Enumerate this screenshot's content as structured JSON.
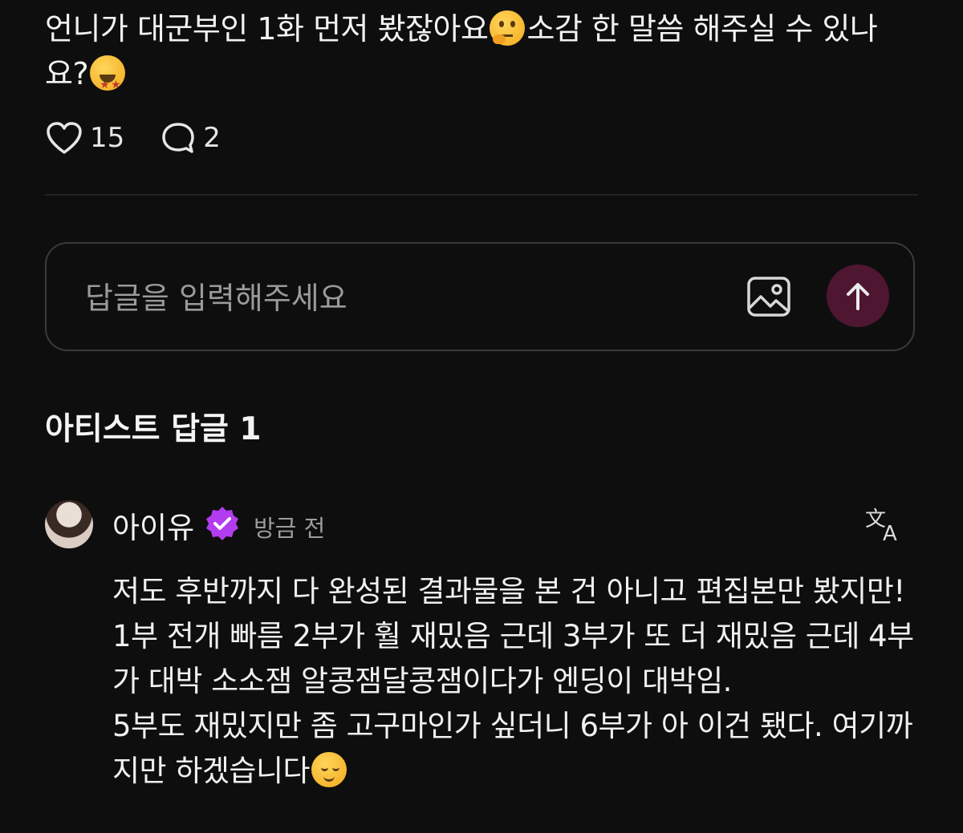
{
  "post": {
    "text_part1": "언니가 대군부인 1화 먼저 봤잖아요",
    "text_part2": "소감 한 말씀 해주실 수 있나요?",
    "emoji1": "thinking-face",
    "emoji2": "star-struck"
  },
  "stats": {
    "likes": "15",
    "comments": "2"
  },
  "reply_box": {
    "placeholder": "답글을 입력해주세요",
    "value": "",
    "send_button_color": "#4f1632"
  },
  "section": {
    "title": "아티스트 답글 1"
  },
  "comment": {
    "author": "아이유",
    "timestamp": "방금 전",
    "badge_color": "#b43cf0",
    "lines": [
      "저도 후반까지 다 완성된 결과물을 본 건 아니고 편집본만 봤지만!",
      "1부 전개 빠름 2부가 훨 재밌음 근데 3부가 또 더 재밌음 근데 4부가 대박 소소잼 알콩잼달콩잼이다가 엔딩이 대박임.",
      "5부도 재밌지만 좀 고구마인가 싶더니 6부가 아 이건 됐다. 여기까지만 하겠습니다"
    ],
    "end_emoji": "relieved-face"
  }
}
